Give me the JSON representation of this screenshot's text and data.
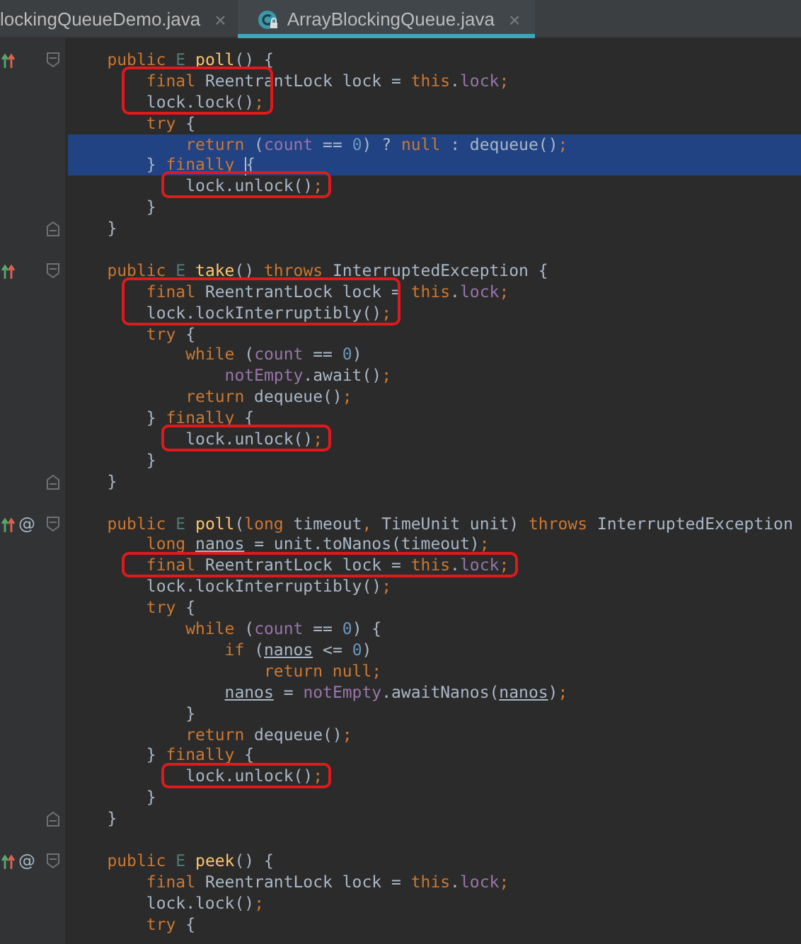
{
  "tabs": [
    {
      "label": "lockingQueueDemo.java",
      "close": "×",
      "selected": false,
      "icon": false
    },
    {
      "label": "ArrayBlockingQueue.java",
      "close": "×",
      "selected": true,
      "icon": true
    }
  ],
  "methods": [
    {
      "override": true,
      "closed": true,
      "lines": [
        {
          "selected": false,
          "boxed": false,
          "tokens": [
            {
              "kind": "keyword",
              "text": "public "
            },
            {
              "kind": "type",
              "text": "E "
            },
            {
              "kind": "method",
              "text": "poll"
            },
            {
              "kind": "plain",
              "text": "() {"
            }
          ]
        },
        {
          "selected": false,
          "boxed": true,
          "tokens": [
            {
              "kind": "keyword",
              "text": "    final "
            },
            {
              "kind": "plain",
              "text": "ReentrantLock lock = "
            },
            {
              "kind": "keyword",
              "text": "this"
            },
            {
              "kind": "plain",
              "text": "."
            },
            {
              "kind": "field",
              "text": "lock"
            },
            {
              "kind": "keyword",
              "text": ";"
            }
          ]
        },
        {
          "selected": false,
          "boxed": true,
          "tokens": [
            {
              "kind": "plain",
              "text": "    lock.lock()"
            },
            {
              "kind": "keyword",
              "text": ";"
            }
          ]
        },
        {
          "selected": false,
          "boxed": false,
          "tokens": [
            {
              "kind": "keyword",
              "text": "    try "
            },
            {
              "kind": "plain",
              "text": "{"
            }
          ]
        },
        {
          "selected": true,
          "boxed": false,
          "tokens": [
            {
              "kind": "keyword",
              "text": "        return "
            },
            {
              "kind": "plain",
              "text": "("
            },
            {
              "kind": "field",
              "text": "count"
            },
            {
              "kind": "plain",
              "text": " == "
            },
            {
              "kind": "number",
              "text": "0"
            },
            {
              "kind": "plain",
              "text": ") ? "
            },
            {
              "kind": "keyword",
              "text": "null "
            },
            {
              "kind": "plain",
              "text": ": dequeue()"
            },
            {
              "kind": "keyword",
              "text": ";"
            }
          ]
        },
        {
          "selected": true,
          "boxed": false,
          "caret": true,
          "tokens": [
            {
              "kind": "plain",
              "text": "    } "
            },
            {
              "kind": "keyword",
              "text": "finally "
            },
            {
              "kind": "plain",
              "text": "{"
            }
          ]
        },
        {
          "selected": false,
          "boxed": true,
          "tokens": [
            {
              "kind": "plain",
              "text": "        lock.unlock()"
            },
            {
              "kind": "keyword",
              "text": ";"
            }
          ]
        },
        {
          "selected": false,
          "boxed": false,
          "tokens": [
            {
              "kind": "plain",
              "text": "    }"
            }
          ]
        },
        {
          "selected": false,
          "boxed": false,
          "tokens": [
            {
              "kind": "plain",
              "text": "}"
            }
          ]
        }
      ]
    },
    {
      "override": true,
      "closed": true,
      "lines": [
        {
          "selected": false,
          "boxed": false,
          "tokens": [
            {
              "kind": "keyword",
              "text": "public "
            },
            {
              "kind": "type",
              "text": "E "
            },
            {
              "kind": "method",
              "text": "take"
            },
            {
              "kind": "plain",
              "text": "() "
            },
            {
              "kind": "keyword",
              "text": "throws "
            },
            {
              "kind": "plain",
              "text": "InterruptedException {"
            }
          ]
        },
        {
          "selected": false,
          "boxed": true,
          "tokens": [
            {
              "kind": "keyword",
              "text": "    final "
            },
            {
              "kind": "plain",
              "text": "ReentrantLock lock = "
            },
            {
              "kind": "keyword",
              "text": "this"
            },
            {
              "kind": "plain",
              "text": "."
            },
            {
              "kind": "field",
              "text": "lock"
            },
            {
              "kind": "keyword",
              "text": ";"
            }
          ]
        },
        {
          "selected": false,
          "boxed": true,
          "tokens": [
            {
              "kind": "plain",
              "text": "    lock.lockInterruptibly()"
            },
            {
              "kind": "keyword",
              "text": ";"
            }
          ]
        },
        {
          "selected": false,
          "boxed": false,
          "tokens": [
            {
              "kind": "keyword",
              "text": "    try "
            },
            {
              "kind": "plain",
              "text": "{"
            }
          ]
        },
        {
          "selected": false,
          "boxed": false,
          "tokens": [
            {
              "kind": "keyword",
              "text": "        while "
            },
            {
              "kind": "plain",
              "text": "("
            },
            {
              "kind": "field",
              "text": "count"
            },
            {
              "kind": "plain",
              "text": " == "
            },
            {
              "kind": "number",
              "text": "0"
            },
            {
              "kind": "plain",
              "text": ")"
            }
          ]
        },
        {
          "selected": false,
          "boxed": false,
          "tokens": [
            {
              "kind": "field",
              "text": "            notEmpty"
            },
            {
              "kind": "plain",
              "text": ".await()"
            },
            {
              "kind": "keyword",
              "text": ";"
            }
          ]
        },
        {
          "selected": false,
          "boxed": false,
          "tokens": [
            {
              "kind": "keyword",
              "text": "        return "
            },
            {
              "kind": "plain",
              "text": "dequeue()"
            },
            {
              "kind": "keyword",
              "text": ";"
            }
          ]
        },
        {
          "selected": false,
          "boxed": false,
          "tokens": [
            {
              "kind": "plain",
              "text": "    } "
            },
            {
              "kind": "keyword",
              "text": "finally "
            },
            {
              "kind": "plain",
              "text": "{"
            }
          ]
        },
        {
          "selected": false,
          "boxed": true,
          "tokens": [
            {
              "kind": "plain",
              "text": "        lock.unlock()"
            },
            {
              "kind": "keyword",
              "text": ";"
            }
          ]
        },
        {
          "selected": false,
          "boxed": false,
          "tokens": [
            {
              "kind": "plain",
              "text": "    }"
            }
          ]
        },
        {
          "selected": false,
          "boxed": false,
          "tokens": [
            {
              "kind": "plain",
              "text": "}"
            }
          ]
        }
      ]
    },
    {
      "override": true,
      "at": "@",
      "closed": true,
      "lines": [
        {
          "selected": false,
          "boxed": false,
          "tokens": [
            {
              "kind": "keyword",
              "text": "public "
            },
            {
              "kind": "type",
              "text": "E "
            },
            {
              "kind": "method",
              "text": "poll"
            },
            {
              "kind": "plain",
              "text": "("
            },
            {
              "kind": "keyword",
              "text": "long "
            },
            {
              "kind": "plain",
              "text": "timeout"
            },
            {
              "kind": "keyword",
              "text": ", "
            },
            {
              "kind": "plain",
              "text": "TimeUnit unit) "
            },
            {
              "kind": "keyword",
              "text": "throws "
            },
            {
              "kind": "plain",
              "text": "InterruptedException"
            }
          ]
        },
        {
          "selected": false,
          "boxed": false,
          "tokens": [
            {
              "kind": "keyword",
              "text": "    long "
            },
            {
              "kind": "local",
              "text": "nanos"
            },
            {
              "kind": "plain",
              "text": " = unit.toNanos(timeout)"
            },
            {
              "kind": "keyword",
              "text": ";"
            }
          ]
        },
        {
          "selected": false,
          "boxed": true,
          "tokens": [
            {
              "kind": "keyword",
              "text": "    final "
            },
            {
              "kind": "plain",
              "text": "ReentrantLock lock = "
            },
            {
              "kind": "keyword",
              "text": "this"
            },
            {
              "kind": "plain",
              "text": "."
            },
            {
              "kind": "field",
              "text": "lock"
            },
            {
              "kind": "keyword",
              "text": ";"
            }
          ]
        },
        {
          "selected": false,
          "boxed": false,
          "tokens": [
            {
              "kind": "plain",
              "text": "    lock.lockInterruptibly()"
            },
            {
              "kind": "keyword",
              "text": ";"
            }
          ]
        },
        {
          "selected": false,
          "boxed": false,
          "tokens": [
            {
              "kind": "keyword",
              "text": "    try "
            },
            {
              "kind": "plain",
              "text": "{"
            }
          ]
        },
        {
          "selected": false,
          "boxed": false,
          "tokens": [
            {
              "kind": "keyword",
              "text": "        while "
            },
            {
              "kind": "plain",
              "text": "("
            },
            {
              "kind": "field",
              "text": "count"
            },
            {
              "kind": "plain",
              "text": " == "
            },
            {
              "kind": "number",
              "text": "0"
            },
            {
              "kind": "plain",
              "text": ") {"
            }
          ]
        },
        {
          "selected": false,
          "boxed": false,
          "tokens": [
            {
              "kind": "keyword",
              "text": "            if "
            },
            {
              "kind": "plain",
              "text": "("
            },
            {
              "kind": "local",
              "text": "nanos"
            },
            {
              "kind": "plain",
              "text": " <= "
            },
            {
              "kind": "number",
              "text": "0"
            },
            {
              "kind": "plain",
              "text": ")"
            }
          ]
        },
        {
          "selected": false,
          "boxed": false,
          "tokens": [
            {
              "kind": "keyword",
              "text": "                return null;"
            }
          ]
        },
        {
          "selected": false,
          "boxed": false,
          "tokens": [
            {
              "kind": "local",
              "text": "            nanos"
            },
            {
              "kind": "plain",
              "text": " = "
            },
            {
              "kind": "field",
              "text": "notEmpty"
            },
            {
              "kind": "plain",
              "text": ".awaitNanos("
            },
            {
              "kind": "local",
              "text": "nanos"
            },
            {
              "kind": "plain",
              "text": ")"
            },
            {
              "kind": "keyword",
              "text": ";"
            }
          ]
        },
        {
          "selected": false,
          "boxed": false,
          "tokens": [
            {
              "kind": "plain",
              "text": "        }"
            }
          ]
        },
        {
          "selected": false,
          "boxed": false,
          "tokens": [
            {
              "kind": "keyword",
              "text": "        return "
            },
            {
              "kind": "plain",
              "text": "dequeue()"
            },
            {
              "kind": "keyword",
              "text": ";"
            }
          ]
        },
        {
          "selected": false,
          "boxed": false,
          "tokens": [
            {
              "kind": "plain",
              "text": "    } "
            },
            {
              "kind": "keyword",
              "text": "finally "
            },
            {
              "kind": "plain",
              "text": "{"
            }
          ]
        },
        {
          "selected": false,
          "boxed": true,
          "tokens": [
            {
              "kind": "plain",
              "text": "        lock.unlock()"
            },
            {
              "kind": "keyword",
              "text": ";"
            }
          ]
        },
        {
          "selected": false,
          "boxed": false,
          "tokens": [
            {
              "kind": "plain",
              "text": "    }"
            }
          ]
        },
        {
          "selected": false,
          "boxed": false,
          "tokens": [
            {
              "kind": "plain",
              "text": "}"
            }
          ]
        }
      ]
    },
    {
      "override": true,
      "at": "@",
      "closed": false,
      "lines": [
        {
          "selected": false,
          "boxed": false,
          "tokens": [
            {
              "kind": "keyword",
              "text": "public "
            },
            {
              "kind": "type",
              "text": "E "
            },
            {
              "kind": "method",
              "text": "peek"
            },
            {
              "kind": "plain",
              "text": "() {"
            }
          ]
        },
        {
          "selected": false,
          "boxed": false,
          "tokens": [
            {
              "kind": "keyword",
              "text": "    final "
            },
            {
              "kind": "plain",
              "text": "ReentrantLock lock = "
            },
            {
              "kind": "keyword",
              "text": "this"
            },
            {
              "kind": "plain",
              "text": "."
            },
            {
              "kind": "field",
              "text": "lock"
            },
            {
              "kind": "keyword",
              "text": ";"
            }
          ]
        },
        {
          "selected": false,
          "boxed": false,
          "tokens": [
            {
              "kind": "plain",
              "text": "    lock.lock()"
            },
            {
              "kind": "keyword",
              "text": ";"
            }
          ]
        },
        {
          "selected": false,
          "boxed": false,
          "tokens": [
            {
              "kind": "keyword",
              "text": "    try "
            },
            {
              "kind": "plain",
              "text": "{"
            }
          ]
        }
      ]
    }
  ]
}
